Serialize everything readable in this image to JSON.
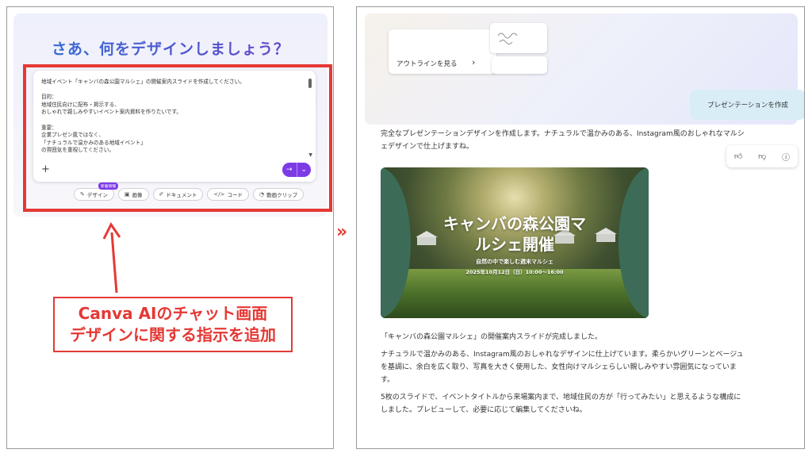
{
  "left": {
    "heading": "さあ、何をデザインしましょう？",
    "prompt_lines": [
      "地域イベント「キャンバの森公園マルシェ」の開催案内スライドを作成してください。",
      "",
      "目的：",
      "地域住民向けに配布・掲示する、",
      "おしゃれで親しみやすいイベント案内資料を作りたいです。",
      "",
      "重要：",
      "企業プレゼン風ではなく、",
      "「ナチュラルで温かみのある地域イベント」",
      "の雰囲気を重視してください。"
    ],
    "chips": [
      {
        "label": "デザイン",
        "icon": "✎",
        "badge": "新着情報"
      },
      {
        "label": "画像",
        "icon": "▣"
      },
      {
        "label": "ドキュメント",
        "icon": "✐"
      },
      {
        "label": "コード",
        "icon": "</>"
      },
      {
        "label": "動画クリップ",
        "icon": "◔"
      }
    ],
    "callout_line1": "Canva AIのチャット画面",
    "callout_line2": "デザインに関する指示を追加"
  },
  "transition_arrow": "»",
  "right": {
    "outline_label": "アウトラインを見る",
    "user_message": "プレゼンテーションを作成",
    "intro_lines": [
      "完全なプレゼンテーションデザインを作成します。ナチュラルで温かみのある、Instagram風のおしゃれなマルシ",
      "ェデザインで仕上げますね。"
    ],
    "slide": {
      "title_line1": "キャンバの森公園マ",
      "title_line2": "ルシェ開催",
      "subtitle": "自然の中で楽しむ週末マルシェ",
      "date": "2025年10月12日（日）10:00〜16:00"
    },
    "body_para1": "「キャンバの森公園マルシェ」の開催案内スライドが完成しました。",
    "body_para2_lines": [
      "ナチュラルで温かみのある、Instagram風のおしゃれなデザインに仕上げています。柔らかいグリーンとベージュ",
      "を基調に、余白を広く取り、写真を大きく使用した、女性向けマルシェらしい親しみやすい雰囲気になっていま",
      "す。"
    ],
    "body_para3_lines": [
      "5枚のスライドで、イベントタイトルから来場案内まで、地域住民の方が「行ってみたい」と思えるような構成に",
      "しました。プレビューして、必要に応じて編集してくださいね。"
    ]
  },
  "colors": {
    "accent_red": "#e53935",
    "brand_purple": "#7d3be6",
    "slide_green": "#3c6c57"
  }
}
